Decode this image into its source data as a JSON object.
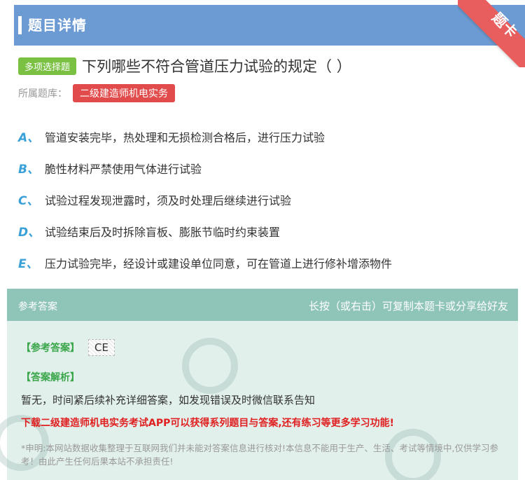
{
  "header": {
    "title": "题目详情"
  },
  "ribbon": {
    "text": "题卡"
  },
  "question": {
    "type_tag": "多项选择题",
    "text": "下列哪些不符合管道压力试验的规定（    ）"
  },
  "bank": {
    "label": "所属题库：",
    "name": "二级建造师机电实务"
  },
  "options": [
    {
      "letter": "A、",
      "text": "管道安装完毕，热处理和无损检测合格后，进行压力试验"
    },
    {
      "letter": "B、",
      "text": "脆性材料严禁使用气体进行试验"
    },
    {
      "letter": "C、",
      "text": "试验过程发现泄露时，须及时处理后继续进行试验"
    },
    {
      "letter": "D、",
      "text": "试验结束后及时拆除盲板、膨胀节临时约束装置"
    },
    {
      "letter": "E、",
      "text": "压力试验完毕，经设计或建设单位同意，可在管道上进行修补增添物件"
    }
  ],
  "answer": {
    "head_left": "参考答案",
    "head_right": "长按（或右击）可复制本题卡或分享给好友",
    "ref_title": "【参考答案】",
    "ref_value": "CE",
    "exp_title": "【答案解析】",
    "exp_text": "暂无，时间紧后续补充详细答案，如发现错误及时微信联系告知",
    "promo": "下载二级建造师机电实务考试APP可以获得系列题目与答案,还有练习等更多学习功能!",
    "disclaimer": "*申明:本网站数据收集整理于互联网我们并未能对答案信息进行核对!本信息不能用于生产、生活、考试等情境中,仅供学习参考！由此产生任何后果本站不承担责任!"
  },
  "colors": {
    "header": "#6b9bd2",
    "ribbon": "#e85d5d",
    "type_tag": "#7ac143",
    "bank_tag": "#e24b4b",
    "option_letter": "#3aa0d8",
    "answer_head": "#8fc4b8",
    "answer_bg": "#e2f0ec",
    "promo": "#e02020"
  }
}
